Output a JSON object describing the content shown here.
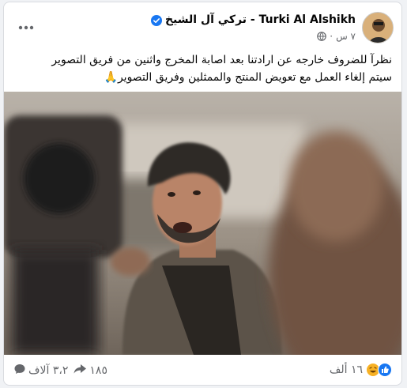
{
  "post": {
    "author": "Turki Al Alshikh - تركي آل الشيخ",
    "time": "٧ س",
    "text_lines": [
      "نظرآ للضروف خارجه عن ارادتنا بعد اصابة المخرج واثنين من فريق التصوير",
      "سيتم إلغاء العمل مع تعويض المنتج والممثلين وفريق التصوير🙏"
    ]
  },
  "footer": {
    "reactions_count": "١٦ ألف",
    "comments_count": "٣،٢ آلاف",
    "shares_count": "١٨٥"
  },
  "colors": {
    "verified": "#1877f2",
    "like": "#1877f2",
    "secondary_text": "#65676b"
  },
  "icons": {
    "more": "more-dots-icon",
    "verified": "verified-badge-icon",
    "privacy": "globe-icon",
    "like": "like-reaction-icon",
    "haha": "haha-reaction-icon",
    "comment": "comment-icon",
    "share": "share-icon"
  }
}
